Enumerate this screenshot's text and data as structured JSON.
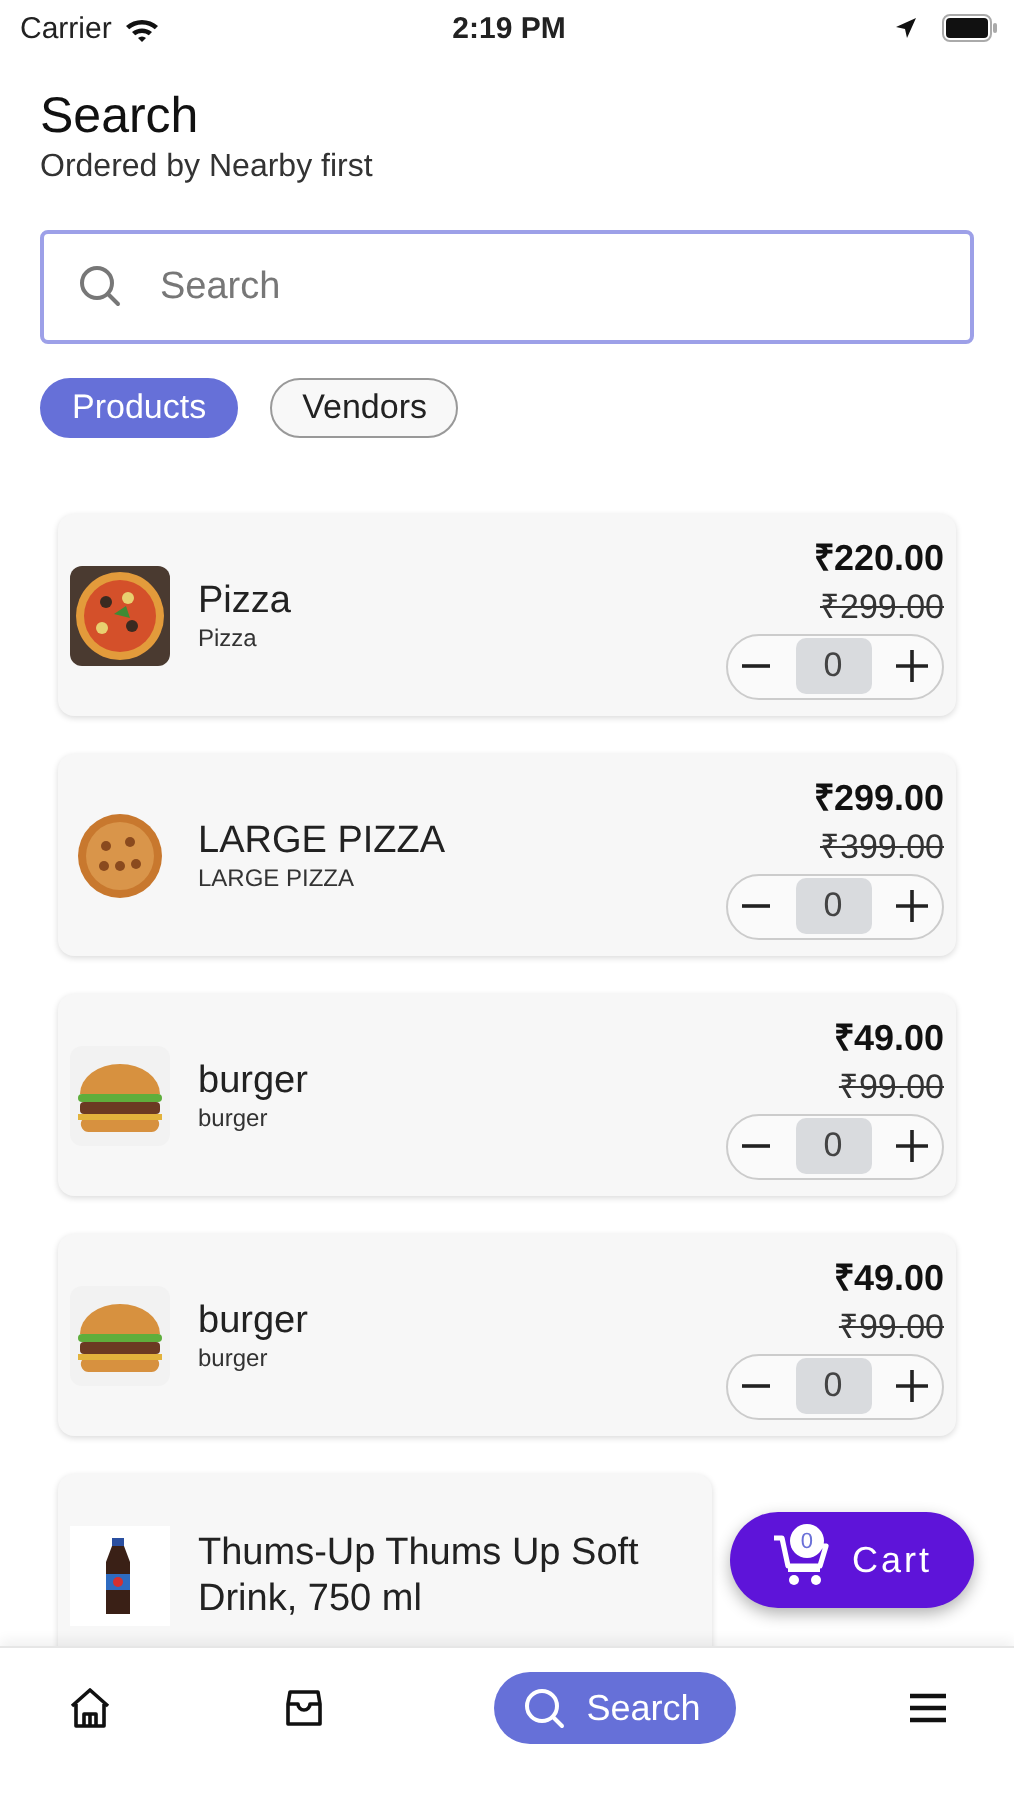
{
  "status_bar": {
    "carrier": "Carrier",
    "time": "2:19 PM"
  },
  "header": {
    "title": "Search",
    "subtitle": "Ordered by Nearby first"
  },
  "search": {
    "placeholder": "Search"
  },
  "filters": [
    {
      "label": "Products",
      "selected": true
    },
    {
      "label": "Vendors",
      "selected": false
    }
  ],
  "products": [
    {
      "name": "Pizza",
      "subtitle": "Pizza",
      "price": "₹220.00",
      "old_price": "₹299.00",
      "quantity": "0"
    },
    {
      "name": "LARGE PIZZA",
      "subtitle": "LARGE PIZZA",
      "price": "₹299.00",
      "old_price": "₹399.00",
      "quantity": "0"
    },
    {
      "name": "burger",
      "subtitle": "burger",
      "price": "₹49.00",
      "old_price": "₹99.00",
      "quantity": "0"
    },
    {
      "name": "burger",
      "subtitle": "burger",
      "price": "₹49.00",
      "old_price": "₹99.00",
      "quantity": "0"
    },
    {
      "name": "Thums-Up Thums Up Soft Drink, 750 ml"
    }
  ],
  "cart": {
    "label": "Cart",
    "count": "0"
  },
  "nav": [
    {
      "kind": "home",
      "selected": false
    },
    {
      "kind": "orders",
      "selected": false
    },
    {
      "kind": "search",
      "label": "Search",
      "selected": true
    },
    {
      "kind": "menu",
      "selected": false
    }
  ]
}
